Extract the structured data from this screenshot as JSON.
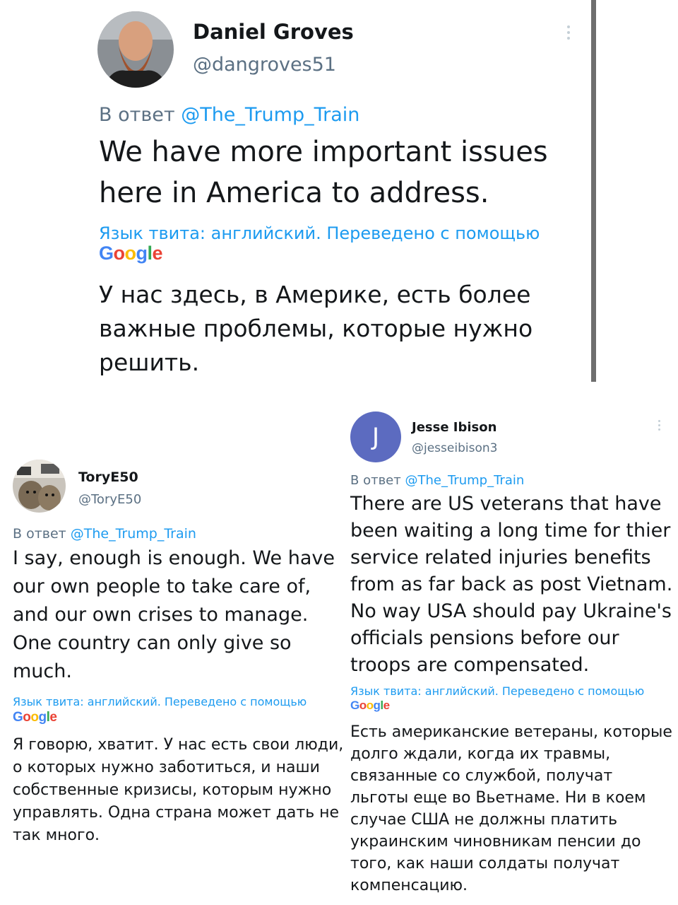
{
  "tweets": [
    {
      "author_name": "Daniel Groves",
      "handle": "@dangroves51",
      "reply_prefix": "В ответ",
      "reply_to": "@The_Trump_Train",
      "text_en": "We have more important issues here in America to address.",
      "lang_note": "Язык твита: английский. Переведено с помощью",
      "translator": "Google",
      "text_ru": "У нас здесь, в Америке, есть более важные проблемы, которые нужно решить.",
      "avatar_icon": "bearded-man-avatar"
    },
    {
      "author_name": "ToryE50",
      "handle": "@ToryE50",
      "reply_prefix": "В ответ",
      "reply_to": "@The_Trump_Train",
      "text_en": "I say, enough is enough. We have our own people to take care of, and our own crises to manage. One country can only give so much.",
      "lang_note": "Язык твита: английский. Переведено с помощью",
      "translator": "Google",
      "text_ru": "Я говорю, хватит. У нас есть свои люди, о которых нужно заботиться, и наши собственные кризисы, которым нужно управлять. Одна страна может дать не так много.",
      "avatar_icon": "cats-avatar"
    },
    {
      "author_name": "Jesse Ibison",
      "handle": "@jesseibison3",
      "avatar_letter": "J",
      "reply_prefix": "В ответ",
      "reply_to": "@The_Trump_Train",
      "text_en": "There are US veterans that have been waiting a long time for thier service related injuries benefits from as far back as post Vietnam. No way USA should pay Ukraine's officials pensions before our troops are compensated.",
      "lang_note": "Язык твита: английский. Переведено с помощью",
      "translator": "Google",
      "text_ru": "Есть американские ветераны, которые долго ждали, когда их травмы, связанные со службой, получат льготы еще во Вьетнаме. Ни в коем случае США не должны платить украинским чиновникам пенсии до того, как наши солдаты получат компенсацию.",
      "avatar_color": "#5c6bc0"
    }
  ],
  "colors": {
    "link": "#1d9bf0",
    "secondary": "#5b7083",
    "text": "#14171a"
  }
}
